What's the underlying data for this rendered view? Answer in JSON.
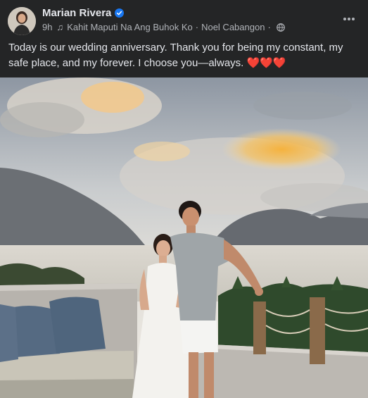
{
  "post": {
    "author": "Marian Rivera",
    "timestamp": "9h",
    "song": "Kahit Maputi Na Ang Buhok Ko",
    "artist": "Noel Cabangon",
    "separator": "·",
    "caption": "Today is our wedding anniversary. Thank you for being my constant, my safe place, and my forever. I choose you—always.",
    "reaction_hearts": "❤️❤️❤️"
  },
  "icons": {
    "verified": "verified-badge-icon",
    "music": "music-note-icon",
    "audience": "globe-icon",
    "more": "more-horizontal-icon"
  },
  "colors": {
    "background": "#242526",
    "text_primary": "#e4e6eb",
    "text_secondary": "#b0b3b8",
    "verified_blue": "#1877f2"
  }
}
